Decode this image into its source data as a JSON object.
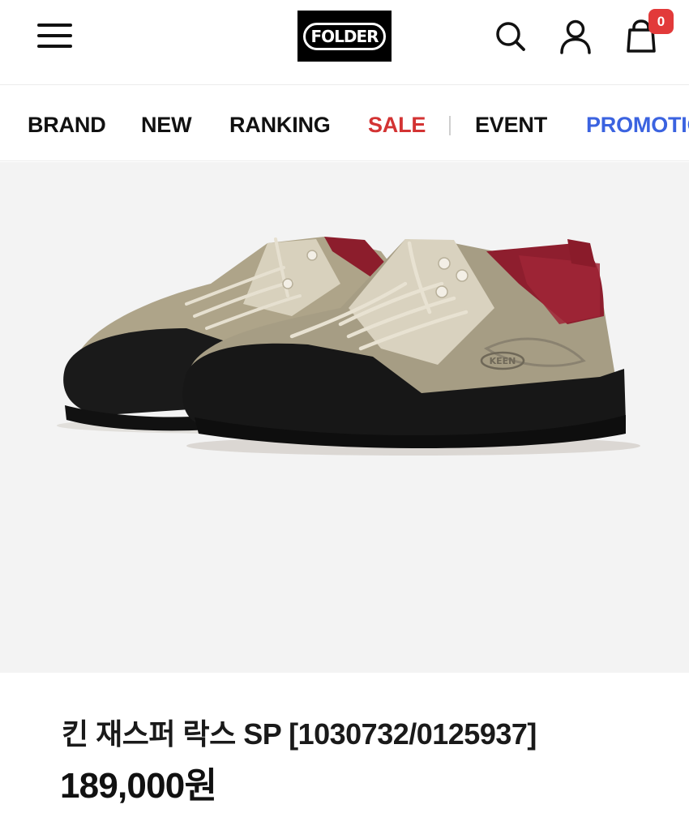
{
  "header": {
    "logo_text": "FOLDER",
    "cart_count": "0",
    "icons": [
      "menu-icon",
      "search-icon",
      "user-icon",
      "cart-icon"
    ],
    "badge_color": "#e23a3a"
  },
  "nav": {
    "items": [
      {
        "label": "BRAND",
        "color": "#111111"
      },
      {
        "label": "NEW",
        "color": "#111111"
      },
      {
        "label": "RANKING",
        "color": "#111111"
      },
      {
        "label": "SALE",
        "color": "#d33333"
      },
      {
        "label": "EVENT",
        "color": "#111111"
      },
      {
        "label": "PROMOTION",
        "color": "#3b63e0"
      }
    ]
  },
  "product": {
    "image_alt_icon": "shoe-image",
    "brand_mark": "KEEN",
    "title": "킨 재스퍼 락스 SP [1030732/0125937]",
    "price": "189,000원"
  }
}
